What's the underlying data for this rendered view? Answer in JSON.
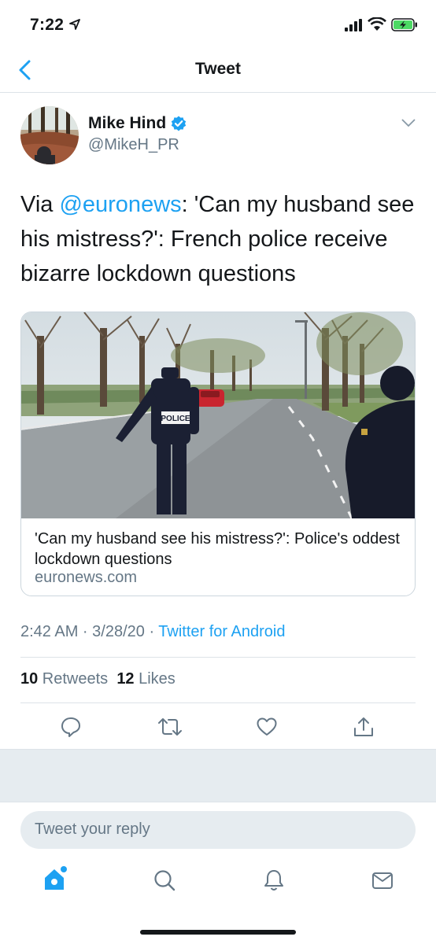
{
  "status_bar": {
    "time": "7:22"
  },
  "nav": {
    "title": "Tweet"
  },
  "tweet": {
    "author_name": "Mike Hind",
    "author_handle": "@MikeH_PR",
    "text_prefix": "Via ",
    "mention": "@euronews",
    "text_body": ": 'Can my husband see his mistress?': French police receive bizarre lockdown questions",
    "card": {
      "badge_text": "POLICE",
      "title": "'Can my husband see his mistress?': Police's oddest lockdown questions",
      "domain": "euronews.com"
    },
    "timestamp": "2:42 AM · 3/28/20 · ",
    "source": "Twitter for Android",
    "retweets_count": "10",
    "retweets_label": " Retweets",
    "likes_count": "12",
    "likes_label": " Likes"
  },
  "reply": {
    "placeholder": "Tweet your reply"
  },
  "icons": {
    "verified": "verified-badge-icon",
    "reply": "comment-icon",
    "retweet": "retweet-icon",
    "like": "heart-icon",
    "share": "share-icon"
  },
  "colors": {
    "accent": "#1da1f2",
    "text": "#14171a",
    "secondary": "#657786",
    "band": "#e6ecf0"
  }
}
